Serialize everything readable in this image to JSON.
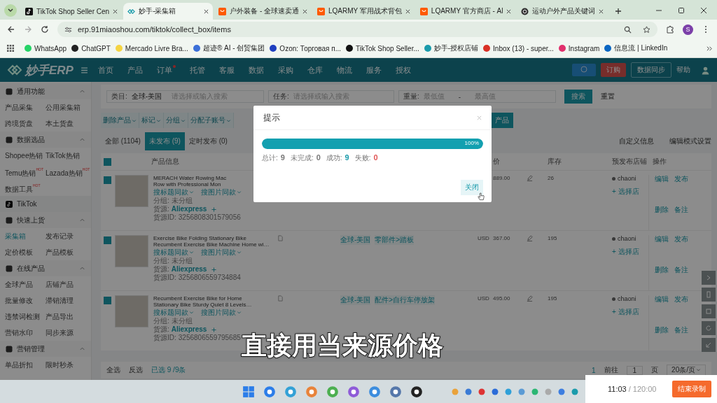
{
  "browser": {
    "tabs": [
      {
        "title": "TikTok Shop Seller Cen",
        "selected": false
      },
      {
        "title": "妙手-采集箱",
        "selected": true
      },
      {
        "title": "户外装备 - 全球速卖通",
        "selected": false
      },
      {
        "title": "LQARMY 军用战术背包",
        "selected": false
      },
      {
        "title": "LQARMY 官方商店 - Al",
        "selected": false
      },
      {
        "title": "运动户外产品关键词",
        "selected": false
      }
    ],
    "address": "erp.91miaoshou.com/tiktok/collect_box/items",
    "profile_initial": "S",
    "bookmarks": [
      {
        "label": "WhatsApp",
        "color": "#25d366"
      },
      {
        "label": "ChatGPT",
        "color": "#222222"
      },
      {
        "label": "Mercado Livre Bra...",
        "color": "#f5d442"
      },
      {
        "label": "超迹® AI - 创贸集团",
        "color": "#3b6fd8"
      },
      {
        "label": "Ozon: Торговая п...",
        "color": "#1f3fbf"
      },
      {
        "label": "TikTok Shop Seller...",
        "color": "#111111"
      },
      {
        "label": "妙手-授权店铺",
        "color": "#1a9bab"
      },
      {
        "label": "Inbox (13) - super...",
        "color": "#d93025"
      },
      {
        "label": "Instagram",
        "color": "#e1306c"
      },
      {
        "label": "信息流 | LinkedIn",
        "color": "#0a66c2"
      }
    ]
  },
  "app": {
    "logo": "妙手ERP",
    "nav": [
      {
        "label": "首页",
        "badge": false
      },
      {
        "label": "产品",
        "badge": false
      },
      {
        "label": "订单",
        "badge": true
      },
      {
        "label": "托管",
        "badge": false
      },
      {
        "label": "客服",
        "badge": false
      },
      {
        "label": "数据",
        "badge": false
      },
      {
        "label": "采购",
        "badge": false
      },
      {
        "label": "仓库",
        "badge": false
      },
      {
        "label": "物流",
        "badge": false
      },
      {
        "label": "服务",
        "badge": false
      },
      {
        "label": "授权",
        "badge": false
      }
    ],
    "order_button": "订购",
    "sync_button": "数据同步",
    "help": "帮助"
  },
  "sidebar": [
    {
      "title": "通用功能",
      "items": [
        {
          "label": "产品采集",
          "kind": "link",
          "selected": false
        },
        {
          "label": "公用采集箱",
          "kind": "link",
          "selected": false
        },
        {
          "label": "跨境货盘",
          "kind": "link",
          "selected": false
        },
        {
          "label": "本土货盘",
          "kind": "link",
          "selected": false
        }
      ]
    },
    {
      "title": "数据选品",
      "items": [
        {
          "label": "Shopee热销",
          "kind": "link",
          "selected": false
        },
        {
          "label": "TikTok热销",
          "kind": "link",
          "selected": false
        },
        {
          "label": "Temu热销",
          "kind": "link",
          "selected": false,
          "badge": "HOT"
        },
        {
          "label": "Lazada热销",
          "kind": "link",
          "selected": false,
          "badge": "HOT"
        },
        {
          "label": "数据工具",
          "kind": "link",
          "selected": false,
          "badge": "HOT"
        },
        {
          "label": "TikTok",
          "kind": "platform",
          "selected": false
        }
      ]
    },
    {
      "title": "快速上货",
      "items": [
        {
          "label": "采集箱",
          "kind": "link",
          "selected": true
        },
        {
          "label": "发布记录",
          "kind": "link",
          "selected": false
        },
        {
          "label": "定价模板",
          "kind": "link",
          "selected": false
        },
        {
          "label": "产品模板",
          "kind": "link",
          "selected": false
        }
      ]
    },
    {
      "title": "在线产品",
      "items": [
        {
          "label": "全球产品",
          "kind": "link",
          "selected": false
        },
        {
          "label": "店铺产品",
          "kind": "link",
          "selected": false
        },
        {
          "label": "批量修改",
          "kind": "link",
          "selected": false
        },
        {
          "label": "滞销清理",
          "kind": "link",
          "selected": false
        },
        {
          "label": "违禁词检测",
          "kind": "link",
          "selected": false
        },
        {
          "label": "产品导出",
          "kind": "link",
          "selected": false
        },
        {
          "label": "营销水印",
          "kind": "link",
          "selected": false
        },
        {
          "label": "同步来源",
          "kind": "link",
          "selected": false
        }
      ]
    },
    {
      "title": "营销管理",
      "items": [
        {
          "label": "单品折扣",
          "kind": "link",
          "selected": false
        },
        {
          "label": "限时秒杀",
          "kind": "link",
          "selected": false
        }
      ]
    }
  ],
  "filters": {
    "category_label": "类目:",
    "category_value": "全球-美国",
    "category_placeholder": "请选择或输入搜索",
    "task_label": "任务:",
    "task_placeholder": "请选择或输入搜索",
    "weight_label": "重量:",
    "weight_min_placeholder": "最低值",
    "weight_dash": "-",
    "weight_max_placeholder": "最高值",
    "search_button": "搜索",
    "reset_button": "重置"
  },
  "actions": [
    "删除产品",
    "标记",
    "分组",
    "分配子账号"
  ],
  "action_primary": "产品",
  "status_tabs": [
    {
      "label": "全部 (1104)",
      "selected": false
    },
    {
      "label": "未发布 (9)",
      "selected": true
    },
    {
      "label": "定时发布 (0)",
      "selected": false
    }
  ],
  "custom_info": "自定义信息",
  "edit_mode": "编辑模式设置",
  "table": {
    "header_checked": true,
    "columns": {
      "info": "产品信息",
      "price": "价",
      "stock": "库存",
      "shop": "预发布店铺",
      "ops": "操作"
    },
    "rows": [
      {
        "checked": true,
        "title": "MERACH Water Rowing Mac",
        "title_2": "Row with Professional Mon",
        "search_title": "搜标题同款",
        "search_image": "搜图片同款",
        "group_label": "分组:",
        "group": "未分组",
        "source_label": "货源:",
        "source": "Aliexpress",
        "source_id_label": "货源ID:",
        "source_id": "3256808301579056",
        "price": "889.00",
        "stock": "26",
        "shop": "chaoni",
        "select_shop": "+ 选择店",
        "ops": [
          "编辑",
          "发布",
          "删除",
          "备注"
        ]
      },
      {
        "checked": true,
        "title": "Exercise Bike Folding Stationary Bike",
        "title_2": "Recumbent Exercise Bike Machine Home wi…",
        "search_title": "搜标题同款",
        "search_image": "搜图片同款",
        "group_label": "分组:",
        "group": "未分组",
        "source_label": "货源:",
        "source": "Aliexpress",
        "source_id_label": "货源ID:",
        "source_id": "3256806559734884",
        "category": "全球-美国",
        "category_path": "零部件>踏板",
        "currency": "USD",
        "price": "367.00",
        "stock": "195",
        "shop": "chaoni",
        "select_shop": "+ 选择店",
        "ops": [
          "编辑",
          "发布",
          "删除",
          "备注"
        ]
      },
      {
        "checked": true,
        "title": "Recumbent Exercise Bike for Home",
        "title_2": "Stationary Bike Sturdy Quiet 8 Levels…",
        "search_title": "搜标题同款",
        "search_image": "搜图片同款",
        "group_label": "分组:",
        "group": "未分组",
        "source_label": "货源:",
        "source": "Aliexpress",
        "source_id_label": "货源ID:",
        "source_id": "3256806559795685",
        "category": "全球-美国",
        "category_path": "配件>自行车停放架",
        "currency": "USD",
        "price": "495.00",
        "stock": "195",
        "shop": "chaoni",
        "select_shop": "+ 选择店",
        "ops": [
          "编辑",
          "发布",
          "删除",
          "备注"
        ]
      }
    ]
  },
  "footer": {
    "select_all": "全选",
    "invert": "反选",
    "selected": "已选 9 /9条",
    "page": "1",
    "goto": "前往",
    "goto_value": "1",
    "page_unit": "页",
    "page_size": "20条/页"
  },
  "dialog": {
    "title": "提示",
    "level": 1.0,
    "percent": "100%",
    "stats": [
      {
        "label": "总计:",
        "value": "9",
        "color": "#777777"
      },
      {
        "label": "未完成:",
        "value": "0",
        "color": "#777777"
      },
      {
        "label": "成功:",
        "value": "9",
        "color": "#1a9bab"
      },
      {
        "label": "失败:",
        "value": "0",
        "color": "#e05555"
      }
    ],
    "close_button": "关闭"
  },
  "subtitle": "直接用当来源价格",
  "recorder": {
    "elapsed": "11:03",
    "total": "/ 120:00",
    "stop_button": "结束录制"
  }
}
